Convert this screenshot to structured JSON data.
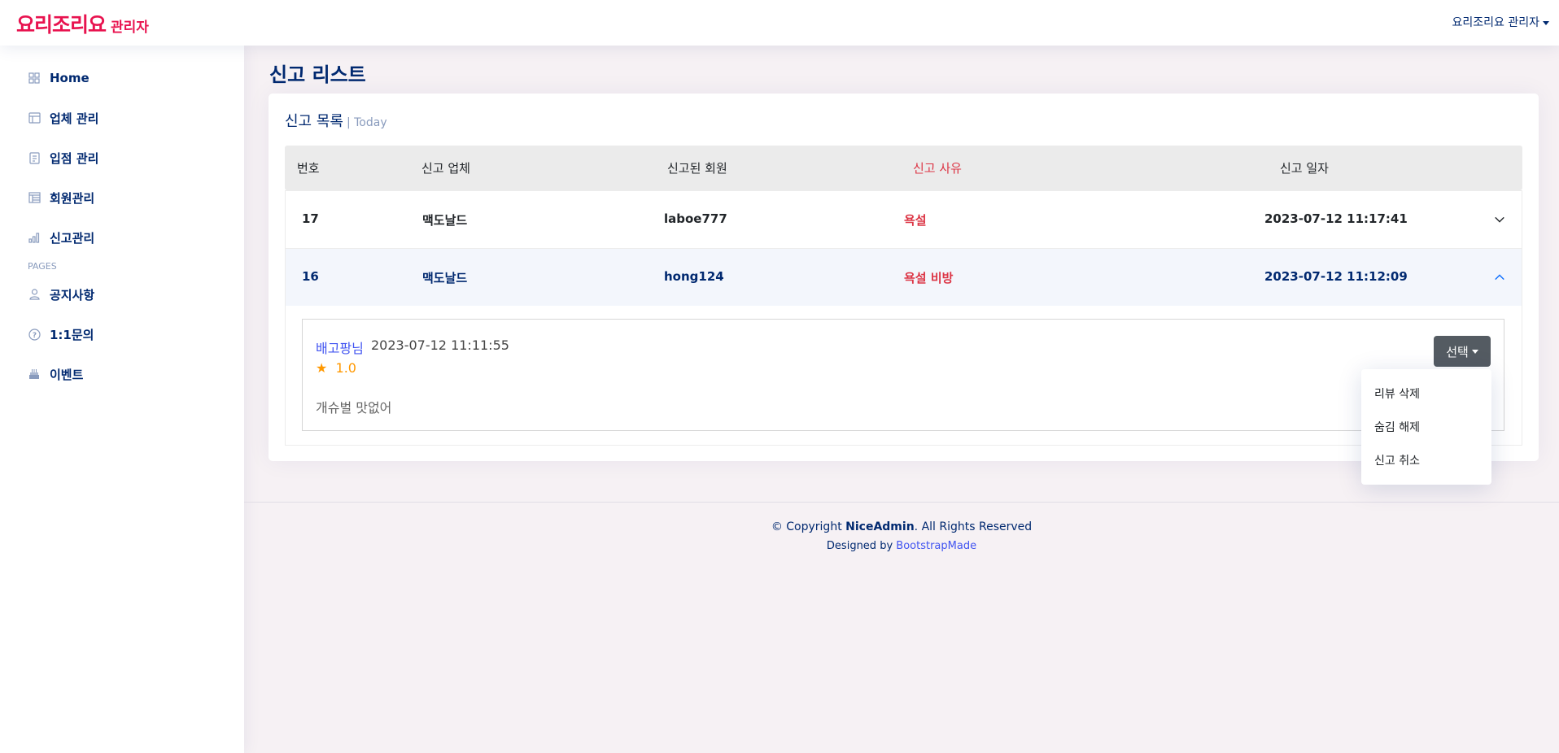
{
  "header": {
    "logo_main": "요리조리요",
    "logo_sub": "관리자",
    "profile_label": "요리조리요 관리자"
  },
  "sidebar": {
    "items": [
      {
        "label": "Home",
        "icon": "grid-icon"
      },
      {
        "label": "업체 관리",
        "icon": "layout-icon"
      },
      {
        "label": "입점 관리",
        "icon": "journal-icon"
      },
      {
        "label": "회원관리",
        "icon": "table-icon"
      },
      {
        "label": "신고관리",
        "icon": "bar-chart-icon"
      }
    ],
    "heading": "PAGES",
    "pages": [
      {
        "label": "공지사항",
        "icon": "person-icon"
      },
      {
        "label": "1:1문의",
        "icon": "question-circle-icon"
      },
      {
        "label": "이벤트",
        "icon": "cake-icon"
      }
    ]
  },
  "main": {
    "page_title": "신고 리스트",
    "card_title": "신고 목록",
    "card_subtitle": "| Today",
    "columns": [
      "번호",
      "신고 업체",
      "신고된 회원",
      "신고 사유",
      "신고 일자"
    ],
    "rows": [
      {
        "no": "17",
        "store": "맥도날드",
        "member": "laboe777",
        "reason": "욕설",
        "date": "2023-07-12 11:17:41",
        "expanded": false
      },
      {
        "no": "16",
        "store": "맥도날드",
        "member": "hong124",
        "reason": "욕설 비방",
        "date": "2023-07-12 11:12:09",
        "expanded": true
      }
    ],
    "review": {
      "reviewer": "배고팡님",
      "date": "2023-07-12 11:11:55",
      "star": "★",
      "rating": "1.0",
      "text": "개슈벌 맛없어"
    },
    "select_button": "선택",
    "dropdown": [
      "리뷰 삭제",
      "숨김 해제",
      "신고 취소"
    ]
  },
  "footer": {
    "copyright_prefix": "© Copyright",
    "brand": "NiceAdmin",
    "copyright_suffix": ". All Rights Reserved",
    "designed_by": "Designed by",
    "designer": "BootstrapMade"
  },
  "colors": {
    "brand": "#e8134f",
    "navy": "#012970",
    "danger": "#dc3545",
    "link": "#4154f1"
  }
}
